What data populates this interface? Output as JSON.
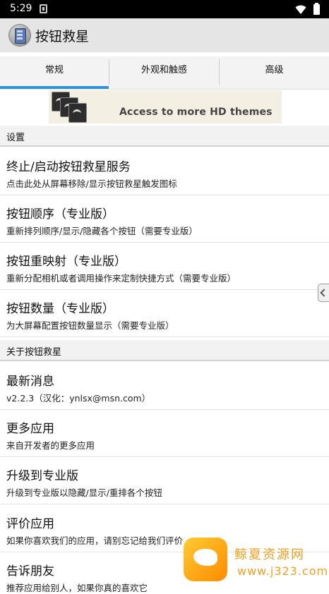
{
  "status_bar": {
    "time": "5:29"
  },
  "app": {
    "title": "按钮救星"
  },
  "tabs": [
    {
      "label": "常规",
      "selected": true
    },
    {
      "label": "外观和触感",
      "selected": false
    },
    {
      "label": "高级",
      "selected": false
    }
  ],
  "banner": {
    "text": "Access to more HD themes"
  },
  "sections": [
    {
      "header": "设置",
      "items": [
        {
          "title": "终止/启动按钮救星服务",
          "subtitle": "点击此处从屏幕移除/显示按钮救星触发图标"
        },
        {
          "title": "按钮顺序（专业版）",
          "subtitle": "重新排列顺序/显示/隐藏各个按钮（需要专业版）"
        },
        {
          "title": "按钮重映射（专业版）",
          "subtitle": "重新分配相机或者调用操作来定制快捷方式（需要专业版）"
        },
        {
          "title": "按钮数量（专业版）",
          "subtitle": "为大屏幕配置按钮数量显示（需要专业版）"
        }
      ]
    },
    {
      "header": "关于按钮救星",
      "items": [
        {
          "title": "最新消息",
          "subtitle": "v2.2.3（汉化：ynlsx@msn.com）"
        },
        {
          "title": "更多应用",
          "subtitle": "来自开发者的更多应用"
        },
        {
          "title": "升级到专业版",
          "subtitle": "升级到专业版以隐藏/显示/重排各个按钮"
        },
        {
          "title": "评价应用",
          "subtitle": "如果你喜欢我们的应用，请别忘记给我们评价"
        },
        {
          "title": "告诉朋友",
          "subtitle": "推荐应用给别人，如果你真的喜欢它"
        }
      ]
    }
  ],
  "watermark": {
    "line1": "鲸夏资源网",
    "line2": "www.j323.com"
  }
}
